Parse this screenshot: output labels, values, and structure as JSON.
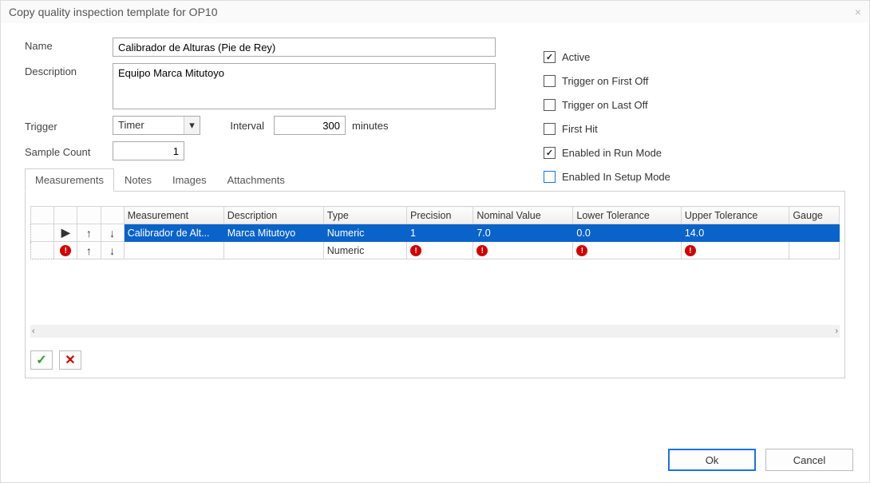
{
  "window": {
    "title": "Copy quality inspection template for  OP10"
  },
  "form": {
    "name_label": "Name",
    "name_value": "Calibrador de Alturas (Pie de Rey)",
    "description_label": "Description",
    "description_value": "Equipo Marca Mitutoyo",
    "trigger_label": "Trigger",
    "trigger_value": "Timer",
    "interval_label": "Interval",
    "interval_value": "300",
    "interval_unit": "minutes",
    "sample_count_label": "Sample Count",
    "sample_count_value": "1"
  },
  "checks": {
    "active": {
      "label": "Active",
      "checked": true
    },
    "trigger_first_off": {
      "label": "Trigger on First Off",
      "checked": false
    },
    "trigger_last_off": {
      "label": "Trigger on Last Off",
      "checked": false
    },
    "first_hit": {
      "label": "First Hit",
      "checked": false
    },
    "enabled_run": {
      "label": "Enabled in Run Mode",
      "checked": true
    },
    "enabled_setup": {
      "label": "Enabled In Setup Mode",
      "checked": false
    }
  },
  "tabs": {
    "measurements": "Measurements",
    "notes": "Notes",
    "images": "Images",
    "attachments": "Attachments"
  },
  "grid": {
    "headers": {
      "measurement": "Measurement",
      "description": "Description",
      "type": "Type",
      "precision": "Precision",
      "nominal": "Nominal Value",
      "lower_tol": "Lower Tolerance",
      "upper_tol": "Upper Tolerance",
      "gauge": "Gauge"
    },
    "rows": [
      {
        "measurement": "Calibrador de Alt...",
        "description": "Marca Mitutoyo",
        "type": "Numeric",
        "precision": "1",
        "nominal": "7.0",
        "lower_tol": "0.0",
        "upper_tol": "14.0",
        "gauge": ""
      },
      {
        "measurement": "",
        "description": "",
        "type": "Numeric",
        "precision": "",
        "nominal": "",
        "lower_tol": "",
        "upper_tol": "",
        "gauge": ""
      }
    ]
  },
  "icons": {
    "error": "!",
    "check": "✓",
    "cross": "✕",
    "up": "↑",
    "down": "↓",
    "play": "▶",
    "dropdown": "▾",
    "scroll_left": "‹",
    "scroll_right": "›",
    "close": "×"
  },
  "footer": {
    "ok": "Ok",
    "cancel": "Cancel"
  }
}
